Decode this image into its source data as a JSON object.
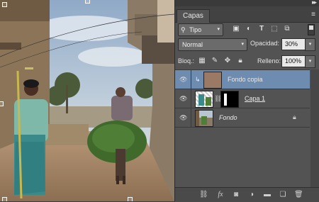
{
  "canvas": {
    "description_icon": "photo-canvas"
  },
  "panel": {
    "tab_label": "Capas",
    "collapse_icon": "double-chevron-right-icon",
    "menu_icon": "panel-menu-icon",
    "filter": {
      "selected": "Tipo",
      "icons": [
        "image-filter-icon",
        "adjustment-filter-icon",
        "type-filter-icon",
        "shape-filter-icon",
        "smart-object-filter-icon"
      ]
    },
    "blend_mode": "Normal",
    "opacity_label": "Opacidad:",
    "opacity_value": "30%",
    "lock_label": "Bloq.:",
    "lock_icons": [
      "lock-transparent-icon",
      "lock-paint-icon",
      "lock-position-icon",
      "lock-all-icon"
    ],
    "fill_label": "Relleno:",
    "fill_value": "100%",
    "layers": [
      {
        "name": "Fondo copia",
        "visible": true,
        "selected": true,
        "clipped": true,
        "thumb_color": "#9a7a64"
      },
      {
        "name": "Capa 1",
        "visible": true,
        "selected": false,
        "has_mask": true,
        "underlined": true
      },
      {
        "name": "Fondo",
        "visible": true,
        "selected": false,
        "italic": true,
        "locked": true
      }
    ],
    "bottom_icons": [
      "link-layers-icon",
      "fx-icon",
      "add-mask-icon",
      "adjustment-layer-icon",
      "new-group-icon",
      "new-layer-icon",
      "trash-icon"
    ]
  },
  "colors": {
    "selected_row": "#6e8bb0",
    "panel_bg": "#535353"
  }
}
